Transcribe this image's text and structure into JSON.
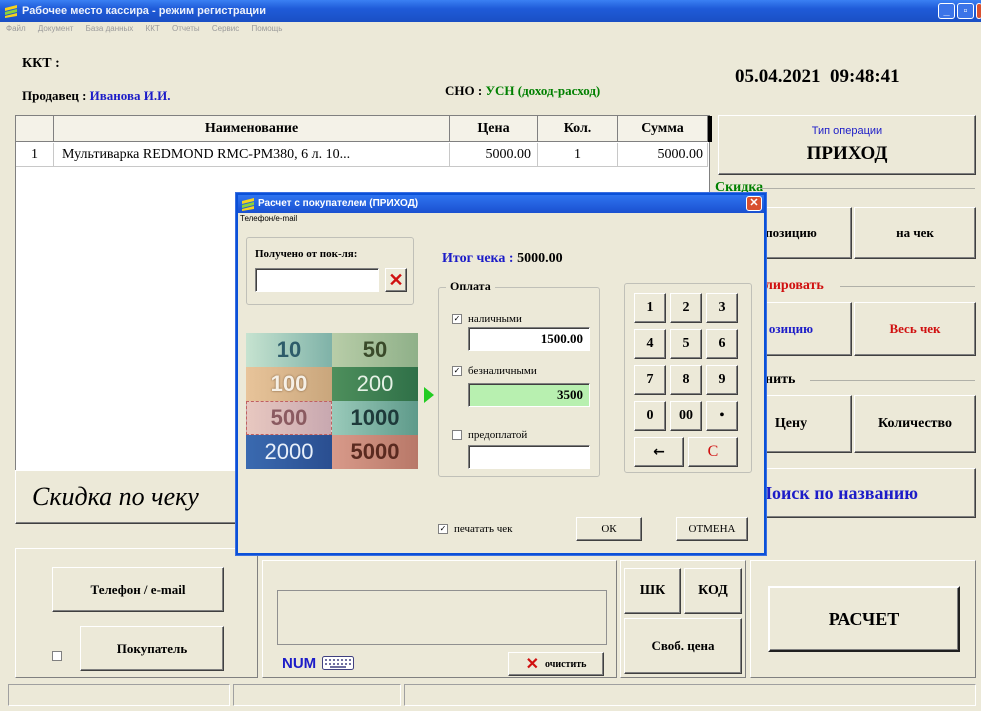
{
  "window": {
    "title": "Рабочее место кассира - режим регистрации"
  },
  "menu": [
    "Файл",
    "Документ",
    "База данных",
    "ККТ",
    "Отчеты",
    "Сервис",
    "Помощь"
  ],
  "header": {
    "kkt_label": "ККТ :",
    "seller_label": "Продавец :",
    "seller_name": "Иванова И.И.",
    "sno_label": "СНО :",
    "sno_value": "УСН (доход-расход)",
    "datetime": "05.04.2021  09:48:41"
  },
  "grid": {
    "columns": [
      "Наименование",
      "Цена",
      "Кол.",
      "Сумма"
    ],
    "rows": [
      {
        "num": "1",
        "name": "Мультиварка REDMOND RMC-PM380, 6 л. 10...",
        "price": "5000.00",
        "qty": "1",
        "sum": "5000.00"
      }
    ]
  },
  "right_panel": {
    "operation_type_label": "Тип операции",
    "operation_type_value": "ПРИХОД",
    "discount_group": "Скидка",
    "discount_position": "позицию",
    "discount_check": "на чек",
    "cancel_group": "лировать",
    "cancel_position": "озицию",
    "cancel_check": "Весь чек",
    "change_group": "нить",
    "change_price": "Цену",
    "change_qty": "Количество",
    "search_name": "Поиск по названию"
  },
  "discount_banner": "Скидка по чеку",
  "bottom": {
    "phone_email": "Телефон / e-mail",
    "buyer": "Покупатель",
    "num_label": "NUM",
    "clear_label": "очистить",
    "barcode": "ШК",
    "code": "КОД",
    "free_price": "Своб. цена",
    "calc": "РАСЧЕТ"
  },
  "dialog": {
    "title": "Расчет с покупателем (ПРИХОД)",
    "menu_item": "Телефон/e-mail",
    "received_label": "Получено от пок-ля:",
    "received_value": "",
    "total_label": "Итог чека :",
    "total_value": "5000.00",
    "payment_group": "Оплата",
    "cash_label": "наличными",
    "cash_value": "1500.00",
    "card_label": "безналичными",
    "card_value": "3500",
    "prepaid_label": "предоплатой",
    "prepaid_value": "",
    "print_label": "печатать чек",
    "ok": "ОК",
    "cancel": "ОТМЕНА",
    "notes": [
      "10",
      "50",
      "100",
      "200",
      "500",
      "1000",
      "2000",
      "5000"
    ],
    "keypad": [
      "1",
      "2",
      "3",
      "4",
      "5",
      "6",
      "7",
      "8",
      "9",
      "0",
      "00",
      "•",
      "←",
      "C"
    ]
  },
  "colors": {
    "accent_blue": "#1C1CC8",
    "accent_green": "#008000",
    "accent_red": "#D01010",
    "selected_field": "#B8F0B0"
  }
}
